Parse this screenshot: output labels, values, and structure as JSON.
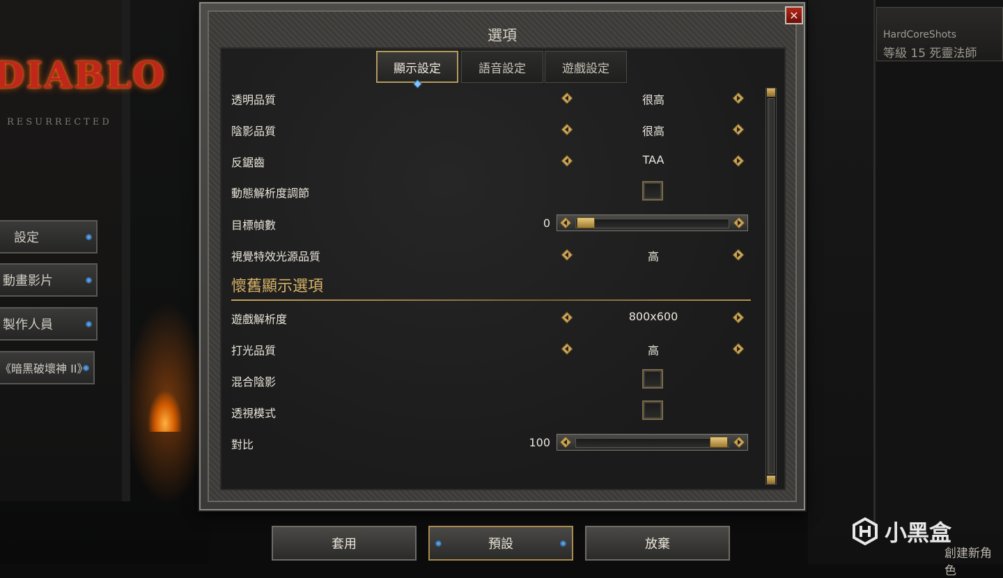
{
  "background": {
    "logo_title": "DIABLO",
    "logo_subtitle": "RESURRECTED",
    "side_menu": [
      "設定",
      "動畫影片",
      "製作人員",
      "《暗黑破壞神 II》"
    ],
    "character": {
      "name": "HardCoreShots",
      "level_class": "等級 15 死靈法師"
    },
    "create_character": "創建新角色",
    "watermark": "小黑盒"
  },
  "dialog": {
    "title": "選項",
    "close_label": "✕",
    "tabs": [
      {
        "label": "顯示設定",
        "active": true
      },
      {
        "label": "語音設定",
        "active": false
      },
      {
        "label": "遊戲設定",
        "active": false
      }
    ],
    "settings": {
      "transparency": {
        "label": "透明品質",
        "value": "很高"
      },
      "shadow": {
        "label": "陰影品質",
        "value": "很高"
      },
      "antialias": {
        "label": "反鋸齒",
        "value": "TAA"
      },
      "dynamic_res": {
        "label": "動態解析度調節",
        "checked": false
      },
      "target_fps": {
        "label": "目標幀數",
        "value": "0",
        "fraction": 0.0
      },
      "vfx_light": {
        "label": "視覺特效光源品質",
        "value": "高"
      }
    },
    "legacy_section_title": "懷舊顯示選項",
    "legacy": {
      "resolution": {
        "label": "遊戲解析度",
        "value": "800x600"
      },
      "lighting": {
        "label": "打光品質",
        "value": "高"
      },
      "blended_shadows": {
        "label": "混合陰影",
        "checked": false
      },
      "perspective": {
        "label": "透視模式",
        "checked": false
      },
      "contrast": {
        "label": "對比",
        "value": "100",
        "fraction": 1.0
      }
    }
  },
  "buttons": {
    "apply": "套用",
    "default": "預設",
    "cancel": "放棄"
  },
  "colors": {
    "gold": "#d8b468",
    "accent_blue": "#6bb8ff",
    "close_red": "#b3261a"
  }
}
